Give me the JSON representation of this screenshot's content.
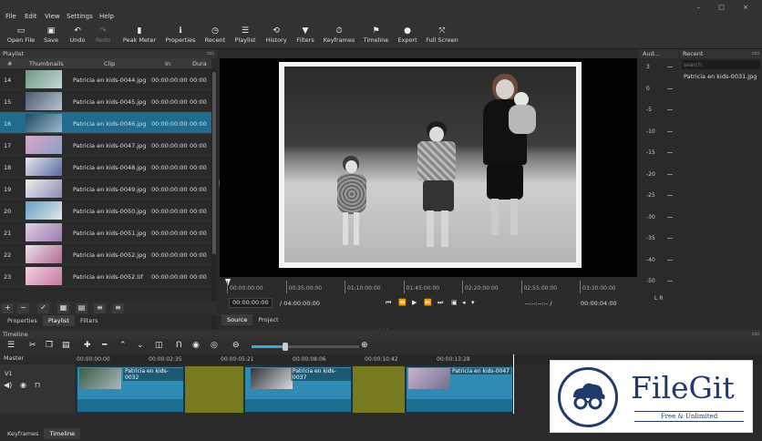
{
  "menu": [
    "File",
    "Edit",
    "View",
    "Settings",
    "Help"
  ],
  "window_controls": "– □ ×",
  "toolbar": [
    {
      "label": "Open File",
      "icon": "folder-icon",
      "enabled": true
    },
    {
      "label": "Save",
      "icon": "save-icon",
      "enabled": true
    },
    {
      "label": "Undo",
      "icon": "undo-icon",
      "enabled": true
    },
    {
      "label": "Redo",
      "icon": "redo-icon",
      "enabled": false
    },
    {
      "label": "Peak Meter",
      "icon": "meter-icon",
      "enabled": true
    },
    {
      "label": "Properties",
      "icon": "info-icon",
      "enabled": true
    },
    {
      "label": "Recent",
      "icon": "clock-icon",
      "enabled": true
    },
    {
      "label": "Playlist",
      "icon": "list-icon",
      "enabled": true
    },
    {
      "label": "History",
      "icon": "history-icon",
      "enabled": true
    },
    {
      "label": "Filters",
      "icon": "filter-icon",
      "enabled": true
    },
    {
      "label": "Keyframes",
      "icon": "stopwatch-icon",
      "enabled": true
    },
    {
      "label": "Timeline",
      "icon": "timeline-icon",
      "enabled": true
    },
    {
      "label": "Export",
      "icon": "export-icon",
      "enabled": true
    },
    {
      "label": "Full Screen",
      "icon": "fullscreen-icon",
      "enabled": true
    }
  ],
  "playlist": {
    "title": "Playlist",
    "columns": [
      "#",
      "Thumbnails",
      "Clip",
      "In",
      "Dura"
    ],
    "rows": [
      {
        "n": "14",
        "clip": "Patricia en kids-0044.jpg",
        "in": "00:00:00:00",
        "du": "00:00"
      },
      {
        "n": "15",
        "clip": "Patricia en kids-0045.jpg",
        "in": "00:00:00:00",
        "du": "00:00"
      },
      {
        "n": "16",
        "clip": "Patricia en kids-0046.jpg",
        "in": "00:00:00:00",
        "du": "00:00",
        "selected": true
      },
      {
        "n": "17",
        "clip": "Patricia en kids-0047.jpg",
        "in": "00:00:00:00",
        "du": "00:00"
      },
      {
        "n": "18",
        "clip": "Patricia en kids-0048.jpg",
        "in": "00:00:00:00",
        "du": "00:00"
      },
      {
        "n": "19",
        "clip": "Patricia en kids-0049.jpg",
        "in": "00:00:00:00",
        "du": "00:00"
      },
      {
        "n": "20",
        "clip": "Patricia en kids-0050.jpg",
        "in": "00:00:00:00",
        "du": "00:00"
      },
      {
        "n": "21",
        "clip": "Patricia en kids-0051.jpg",
        "in": "00:00:00:00",
        "du": "00:00"
      },
      {
        "n": "22",
        "clip": "Patricia en kids-0052.jpg",
        "in": "00:00:00:00",
        "du": "00:00"
      },
      {
        "n": "23",
        "clip": "Patricia en kids-0052.tif",
        "in": "00:00:00:00",
        "du": "00:00"
      }
    ],
    "buttons": [
      "+",
      "−",
      "✓",
      "▦",
      "▤",
      "≡"
    ],
    "tabs": [
      "Properties",
      "Playlist",
      "Filters"
    ]
  },
  "ruler_ticks": [
    "00:00:00:00",
    "00:35:00:00",
    "01:10:00:00",
    "01:45:00:00",
    "02:20:00:00",
    "02:55:00:00",
    "03:30:00:00"
  ],
  "transport": {
    "position": "00:00:00:00",
    "duration": "/ 04:00:00:00",
    "in_out": "--:--:--:-- /",
    "end": "00:00:04:00"
  },
  "source_tabs": [
    "Source",
    "Project"
  ],
  "audio": {
    "title": "Aud...",
    "levels": [
      "3",
      "0",
      "-5",
      "-10",
      "-15",
      "-20",
      "-25",
      "-30",
      "-35",
      "-40",
      "-50"
    ],
    "channels": "L  R"
  },
  "recent": {
    "title": "Recent",
    "placeholder": "search",
    "items": [
      "Patricia en kids-0031.jpg"
    ]
  },
  "timeline": {
    "title": "Timeline",
    "master": "Master",
    "track": "V1",
    "ruler": [
      "00:00:00:00",
      "00:00:02:35",
      "00:00:05:21",
      "00:00:08:06",
      "00:00:10:42",
      "00:00:13:28"
    ],
    "clips": [
      "Patricia en kids-0032",
      "Patricia en kids-0037",
      "Patricia en kids-0047"
    ]
  },
  "bottom_tabs": [
    "Keyframes",
    "Timeline"
  ],
  "logo": {
    "name": "FileGit",
    "tagline": "Free & Unlimited"
  },
  "colors": {
    "selection": "#1f6c8f",
    "clip": "#2e8bb4",
    "gap": "#787a1f",
    "brand": "#203a6b"
  }
}
